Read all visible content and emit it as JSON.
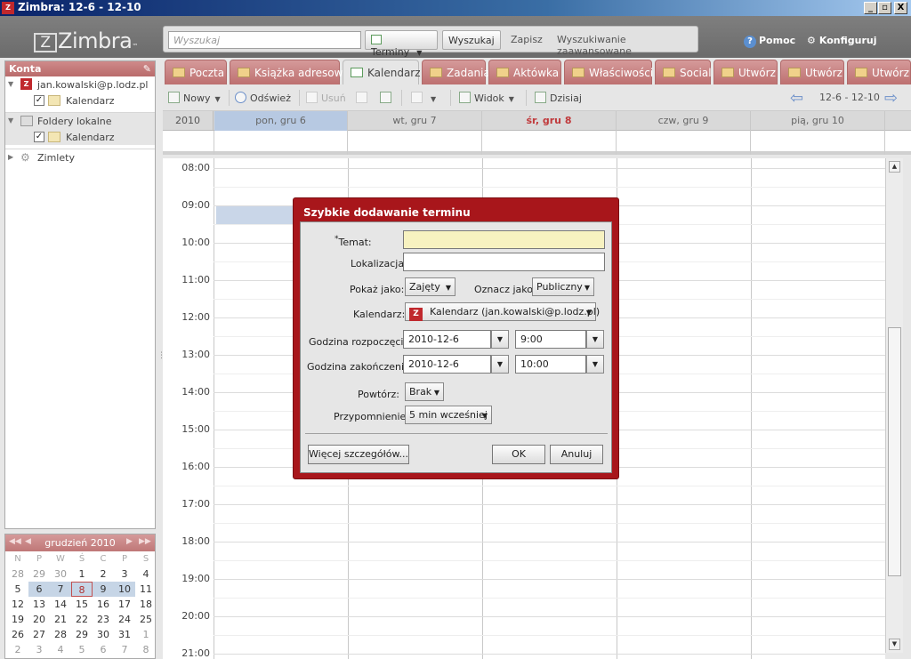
{
  "window": {
    "title": "Zimbra: 12-6 - 12-10",
    "icon": "zimbra-app-icon",
    "controls": [
      "_",
      "▫",
      "X"
    ]
  },
  "header": {
    "logo_mark": "Z",
    "logo_text": "Zimbra",
    "logo_tm": "™",
    "search_placeholder": "Wyszukaj",
    "search_type": "Terminy",
    "search_button": "Wyszukaj",
    "save_link": "Zapisz",
    "advanced_link": "Wyszukiwanie zaawansowane",
    "help_label": "Pomoc",
    "help_icon_glyph": "?",
    "configure_label": "Konfiguruj",
    "configure_icon_glyph": "⚙"
  },
  "sidebar": {
    "header": "Konta",
    "account": "jan.kowalski@p.lodz.pl",
    "account_calendar": "Kalendarz",
    "local_folders": "Foldery lokalne",
    "local_calendar": "Kalendarz",
    "zimlets": "Zimlety",
    "z_glyph": "Z",
    "check_glyph": "✓"
  },
  "minical": {
    "month": "grudzień 2010",
    "nav": {
      "prev_year": "◀◀",
      "prev": "◀",
      "next": "▶",
      "next_year": "▶▶"
    },
    "dow": [
      "N",
      "P",
      "W",
      "Ś",
      "C",
      "P",
      "S"
    ],
    "days": [
      "28",
      "29",
      "30",
      "1",
      "2",
      "3",
      "4",
      "5",
      "6",
      "7",
      "8",
      "9",
      "10",
      "11",
      "12",
      "13",
      "14",
      "15",
      "16",
      "17",
      "18",
      "19",
      "20",
      "21",
      "22",
      "23",
      "24",
      "25",
      "26",
      "27",
      "28",
      "29",
      "30",
      "31",
      "1",
      "2",
      "3",
      "4",
      "5",
      "6",
      "7",
      "8"
    ]
  },
  "tabs": [
    "Poczta",
    "Książka adresowa",
    "Kalendarz",
    "Zadania",
    "Aktówka",
    "Właściwości",
    "Social",
    "Utwórz",
    "Utwórz",
    "Utwórz"
  ],
  "toolbar": {
    "new": "Nowy",
    "refresh": "Odśwież",
    "delete": "Usuń",
    "view": "Widok",
    "today": "Dzisiaj",
    "date_range": "12-6 - 12-10",
    "prev_glyph": "⇦",
    "next_glyph": "⇨",
    "dd_glyph": "▼"
  },
  "calendar": {
    "year": "2010",
    "days": [
      "pon, gru 6",
      "wt, gru 7",
      "śr, gru 8",
      "czw, gru 9",
      "pią, gru 10"
    ],
    "hours": [
      "08:00",
      "09:00",
      "10:00",
      "11:00",
      "12:00",
      "13:00",
      "14:00",
      "15:00",
      "16:00",
      "17:00",
      "18:00",
      "19:00",
      "20:00",
      "21:00"
    ]
  },
  "dialog": {
    "title": "Szybkie dodawanie terminu",
    "required_mark": "*",
    "subject_label": "Temat:",
    "subject_value": "",
    "location_label": "Lokalizacja:",
    "location_value": "",
    "show_as_label": "Pokaż jako:",
    "show_as_value": "Zajęty",
    "mark_as_label": "Oznacz jako:",
    "mark_as_value": "Publiczny",
    "calendar_label": "Kalendarz:",
    "calendar_value": "Kalendarz (jan.kowalski@p.lodz.pl)",
    "start_label": "Godzina rozpoczęcia:",
    "start_date": "2010-12-6",
    "start_time": "9:00",
    "end_label": "Godzina zakończenia:",
    "end_date": "2010-12-6",
    "end_time": "10:00",
    "repeat_label": "Powtórz:",
    "repeat_value": "Brak",
    "reminder_label": "Przypomnienie:",
    "reminder_value": "5 min wcześniej",
    "more_button": "Więcej szczegółów...",
    "ok_button": "OK",
    "cancel_button": "Anuluj",
    "dd_glyph": "▼",
    "cal_glyph": "Z"
  }
}
